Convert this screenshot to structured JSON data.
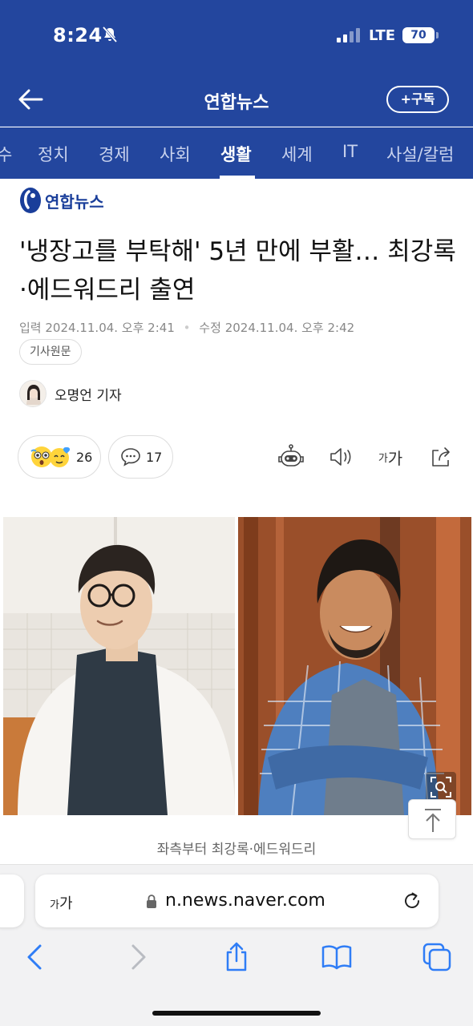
{
  "status_bar": {
    "time": "8:24",
    "network": "LTE",
    "battery": "70"
  },
  "header": {
    "title": "연합뉴스",
    "subscribe_label": "+구독"
  },
  "tabs": [
    {
      "label": "수"
    },
    {
      "label": "정치"
    },
    {
      "label": "경제"
    },
    {
      "label": "사회"
    },
    {
      "label": "생활",
      "active": true
    },
    {
      "label": "세계"
    },
    {
      "label": "IT"
    },
    {
      "label": "사설/칼럼"
    }
  ],
  "article": {
    "source": "연합뉴스",
    "headline": "'냉장고를 부탁해' 5년 만에 부활… 최강록·에드워드리 출연",
    "published_label": "입력",
    "published": "2024.11.04. 오후 2:41",
    "modified_label": "수정",
    "modified": "2024.11.04. 오후 2:42",
    "original_button": "기사원문",
    "reporter": "오명언 기자",
    "reactions_count": "26",
    "comments_count": "17",
    "font_button_small": "가",
    "font_button_large": "가",
    "photo_caption": "좌측부터 최강록·에드워드리"
  },
  "browser": {
    "aa_small": "가",
    "aa_large": "가",
    "url": "n.news.naver.com"
  },
  "colors": {
    "brand": "#23469e",
    "accent": "#1a3e9a"
  }
}
